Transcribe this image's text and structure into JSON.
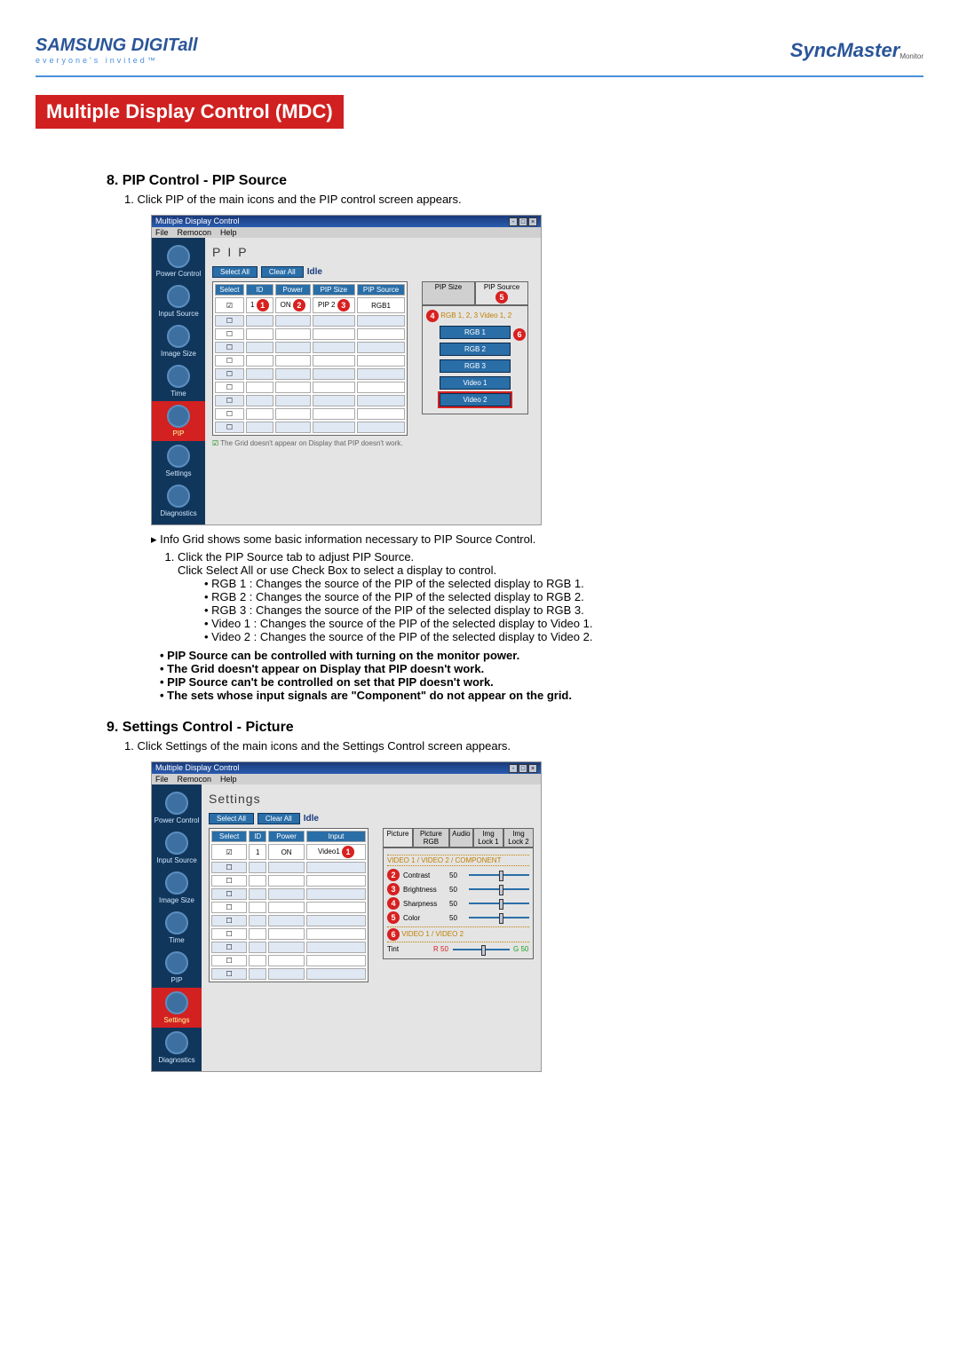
{
  "header": {
    "brand": "SAMSUNG DIGITall",
    "tagline": "everyone's invited™",
    "product": "SyncMaster",
    "product_sub": "Monitor"
  },
  "page_title": "Multiple Display Control (MDC)",
  "section8": {
    "heading": "8. PIP Control - PIP Source",
    "intro": "1.  Click PIP of the main icons and the PIP control screen appears.",
    "grid_note": "The Grid doesn't appear on Display that PIP doesn't work.",
    "info_arrow": "Info Grid shows some basic information necessary to PIP Source Control.",
    "step1": "Click the PIP Source tab to adjust PIP Source.",
    "step1b": "Click Select All or use Check Box to select a display to control.",
    "bullets": [
      "RGB 1 : Changes the source of the PIP of the selected display to RGB 1.",
      "RGB 2 : Changes the source of the PIP of the selected display to RGB 2.",
      "RGB 3 : Changes the source of the PIP of the selected display to RGB 3.",
      "Video 1 : Changes the source of the PIP of the selected display to Video 1.",
      "Video 2 : Changes the source of the PIP of the selected display to Video 2."
    ],
    "bold_bullets": [
      "PIP Source can be controlled with turning on the monitor power.",
      "The Grid doesn't appear on Display that PIP doesn't work.",
      "PIP Source can't be controlled on set that PIP doesn't work.",
      "The sets whose input signals are \"Component\" do not appear on the grid."
    ]
  },
  "section9": {
    "heading": "9. Settings Control - Picture",
    "intro": "1.  Click Settings of the main icons and the Settings Control screen appears."
  },
  "app1": {
    "title": "Multiple Display Control",
    "menu": [
      "File",
      "Remocon",
      "Help"
    ],
    "panel_title": "PIP",
    "select_all": "Select All",
    "clear_all": "Clear All",
    "status": "Idle",
    "cols": [
      "Select",
      "ID",
      "Power",
      "PIP Size",
      "PIP Source"
    ],
    "row1": {
      "id": "1",
      "power": "ON",
      "size": "PIP 2",
      "src": "RGB1"
    },
    "tabs": [
      "PIP Size",
      "PIP Source"
    ],
    "src_title": "RGB 1, 2, 3\nVideo 1, 2",
    "src_buttons": [
      "RGB 1",
      "RGB 2",
      "RGB 3",
      "Video 1",
      "Video 2"
    ],
    "sidebar": [
      "Power Control",
      "Input Source",
      "Image Size",
      "Time",
      "PIP",
      "Settings",
      "Diagnostics"
    ]
  },
  "app2": {
    "title": "Multiple Display Control",
    "menu": [
      "File",
      "Remocon",
      "Help"
    ],
    "panel_title": "Settings",
    "select_all": "Select All",
    "clear_all": "Clear All",
    "status": "Idle",
    "cols": [
      "Select",
      "ID",
      "Power",
      "Input"
    ],
    "row1": {
      "id": "1",
      "power": "ON",
      "input": "Video1"
    },
    "tabs": [
      "Picture",
      "Picture RGB",
      "Audio",
      "Img Lock 1",
      "Img Lock 2"
    ],
    "subhead1": "VIDEO 1 / VIDEO 2 / COMPONENT",
    "sliders1": [
      {
        "lbl": "Contrast",
        "val": "50"
      },
      {
        "lbl": "Brightness",
        "val": "50"
      },
      {
        "lbl": "Sharpness",
        "val": "50"
      },
      {
        "lbl": "Color",
        "val": "50"
      }
    ],
    "subhead2": "VIDEO 1 / VIDEO 2",
    "sliders2": [
      {
        "lbl": "Tint",
        "val": "R 50",
        "val2": "G 50"
      }
    ],
    "sidebar": [
      "Power Control",
      "Input Source",
      "Image Size",
      "Time",
      "PIP",
      "Settings",
      "Diagnostics"
    ]
  },
  "callouts_app1": {
    "1": "1",
    "2": "2",
    "3": "3",
    "4": "4",
    "5": "5",
    "6": "6"
  },
  "callouts_app2": {
    "1": "1",
    "2": "2",
    "3": "3",
    "4": "4",
    "5": "5",
    "6": "6"
  }
}
